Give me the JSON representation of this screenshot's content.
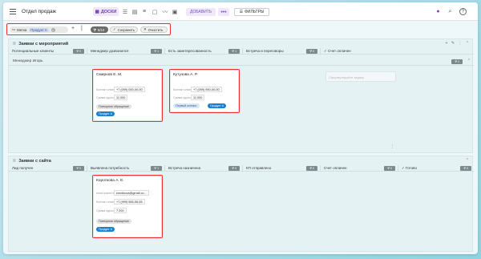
{
  "header": {
    "title": "Отдел продаж",
    "views": {
      "active_label": "ДОСКИ"
    },
    "add_label": "ДОБАВИТЬ",
    "more_label": "•••",
    "filters_label": "ФИЛЬТРЫ"
  },
  "filterbar": {
    "tag_label": "Метка",
    "tag_value": "Продукт А",
    "count_label": "5/10",
    "save_label": "Сохранить",
    "clear_label": "Очистить"
  },
  "group1": {
    "title": "Заявки с мероприятий",
    "columns": [
      {
        "name": "Потенциальные клиенты",
        "count": "0"
      },
      {
        "name": "Менеджер дозвонился",
        "count": "1"
      },
      {
        "name": "Есть заинтересованность",
        "count": "1"
      },
      {
        "name": "Встреча и переговоры",
        "count": "0"
      },
      {
        "name": "Счет оплачен",
        "count": "0",
        "check": "✓"
      }
    ],
    "subgroup": {
      "name": "Менеджер Игорь",
      "count": "2"
    },
    "ghost_placeholder": "Сформулируйте задачу",
    "cards": [
      {
        "name": "Смирнов Е. М.",
        "f1_label": "Контакт клиен...",
        "f1_value": "+7 (099) 000-00-00",
        "f2_label": "Сумма сделки",
        "f2_value": "11 000",
        "pill1": "Повторное обращение",
        "pill2": "Продукт А"
      },
      {
        "name": "Кутузова А. Р.",
        "f1_label": "Контакт клиен...",
        "f1_value": "+7 (099) 990-00-00",
        "f2_label": "Сумма сделки",
        "f2_value": "11 000",
        "pill1": "Первый контакт",
        "pill2": "Продукт А"
      }
    ]
  },
  "group2": {
    "title": "Заявки с сайта",
    "columns": [
      {
        "name": "Лид получен",
        "count": "0"
      },
      {
        "name": "Выявлена потребность",
        "count": "1"
      },
      {
        "name": "Встреча назначена",
        "count": "0"
      },
      {
        "name": "КП отправлено",
        "count": "0"
      },
      {
        "name": "Счет оплачен",
        "count": "0"
      },
      {
        "name": "Готово",
        "count": "0",
        "check": "✓"
      }
    ],
    "cards": [
      {
        "name": "Короткова А. Е.",
        "f0_label": "email клиента",
        "f0_value": "korotkova@gmail.co...",
        "f1_label": "Контакт клиен...",
        "f1_value": "+7 (999) 555-55-55",
        "f2_label": "Сумма сделки",
        "f2_value": "7 200",
        "pill1": "Повторное обращение",
        "pill2": "Продукт А"
      }
    ]
  },
  "colors": {
    "highlight": "#e8322f",
    "accent": "#6c3fb5",
    "tag_blue": "#1a7fd0"
  }
}
